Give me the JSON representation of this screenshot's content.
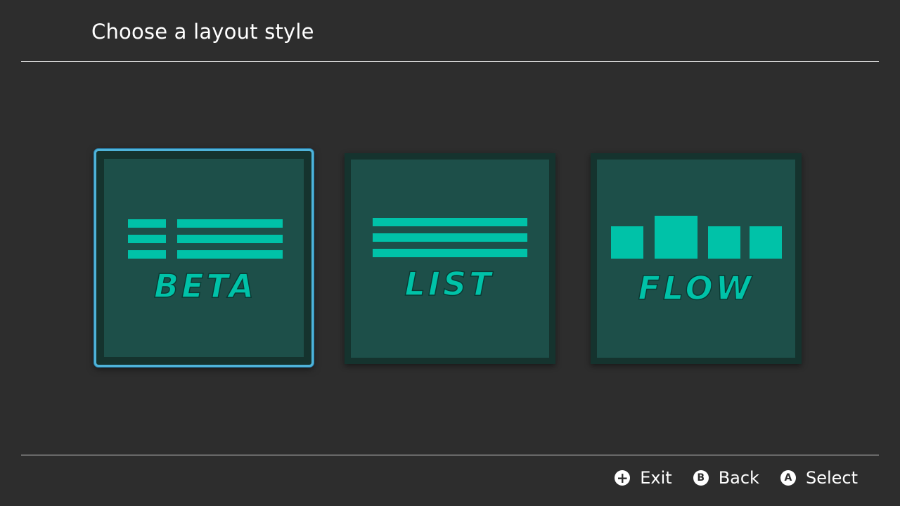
{
  "header": {
    "title": "Choose a layout style"
  },
  "layouts": [
    {
      "label": "BETA",
      "selected": true
    },
    {
      "label": "LIST",
      "selected": false
    },
    {
      "label": "FLOW",
      "selected": false
    }
  ],
  "footer": {
    "hints": [
      {
        "icon": "plus-button-icon",
        "glyph": "+",
        "label": "Exit"
      },
      {
        "icon": "b-button-icon",
        "glyph": "B",
        "label": "Back"
      },
      {
        "icon": "a-button-icon",
        "glyph": "A",
        "label": "Select"
      }
    ]
  },
  "colors": {
    "background": "#2d2d2d",
    "card_outer": "#15332e",
    "card_inner": "#1d4f49",
    "accent": "#00c2a8",
    "selection": "#4fb3d9"
  }
}
